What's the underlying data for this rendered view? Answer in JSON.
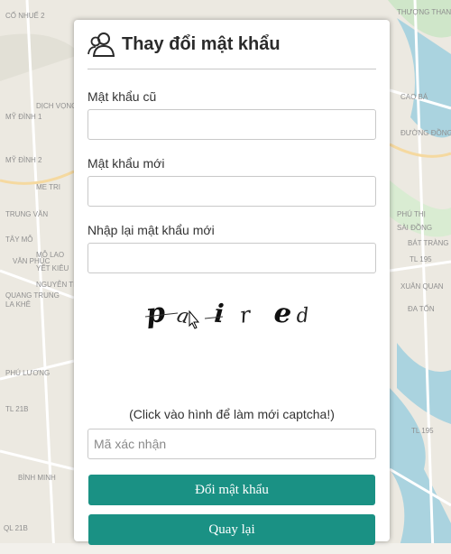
{
  "map": {
    "labels": [
      "CỐ NHUẾ 2",
      "THƯỢNG THANH",
      "DỊCH VỌNG",
      "MỸ ĐÌNH 1",
      "MỸ ĐÌNH 2",
      "ME TRI",
      "TRUNG VĂN",
      "TÂY MỖ",
      "MỖ LAO",
      "VĂN PHÚC",
      "YẾT KIÊU",
      "NGUYỄN TRÃI",
      "LA KHÊ",
      "QUANG TRUNG",
      "PHÚ LƯƠNG",
      "BÌNH MINH",
      "SÀI ĐỒNG",
      "BÁT TRÀNG",
      "XUÂN QUAN",
      "ĐA TỐN",
      "PHÚ THỊ",
      "TL 195",
      "TL 195",
      "TL 21B",
      "QL 21B",
      "CAO BÁ",
      "ĐƯỜNG ĐỒNG"
    ]
  },
  "form": {
    "title": "Thay đổi mật khẩu",
    "old_password_label": "Mật khẩu cũ",
    "new_password_label": "Mật khẩu mới",
    "confirm_password_label": "Nhập lại mật khẩu mới",
    "old_password_value": "",
    "new_password_value": "",
    "confirm_password_value": "",
    "captcha_text": "paired",
    "captcha_hint": "(Click vào hình để làm mới captcha!)",
    "captcha_placeholder": "Mã xác nhận",
    "submit_label": "Đổi mật khẩu",
    "back_label": "Quay lại"
  },
  "colors": {
    "button": "#1a9184",
    "title": "#2b2b2b"
  }
}
